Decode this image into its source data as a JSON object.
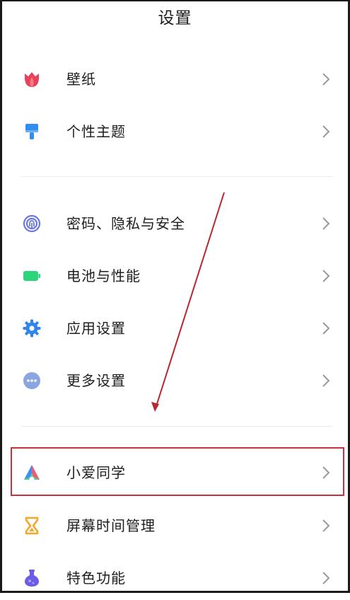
{
  "header": {
    "title": "设置"
  },
  "groups": [
    {
      "items": [
        {
          "label": "壁纸",
          "icon": "tulip-icon"
        },
        {
          "label": "个性主题",
          "icon": "paintbrush-icon"
        }
      ]
    },
    {
      "items": [
        {
          "label": "密码、隐私与安全",
          "icon": "fingerprint-icon"
        },
        {
          "label": "电池与性能",
          "icon": "battery-icon"
        },
        {
          "label": "应用设置",
          "icon": "gear-icon"
        },
        {
          "label": "更多设置",
          "icon": "more-dots-icon"
        }
      ]
    },
    {
      "items": [
        {
          "label": "小爱同学",
          "icon": "xiaoai-icon",
          "highlighted": true
        },
        {
          "label": "屏幕时间管理",
          "icon": "hourglass-icon"
        },
        {
          "label": "特色功能",
          "icon": "flask-icon"
        }
      ]
    }
  ],
  "annotation": {
    "arrow_color": "#b8262e",
    "highlight_color": "#c8323c"
  },
  "colors": {
    "wallpaper": "#e8415a",
    "theme": "#2f8ef0",
    "privacy": "#6a78e6",
    "battery": "#2ed47a",
    "apps": "#2f86e8",
    "more": "#8aa5e0",
    "hourglass": "#f5a623",
    "flask": "#6c5ce7"
  }
}
